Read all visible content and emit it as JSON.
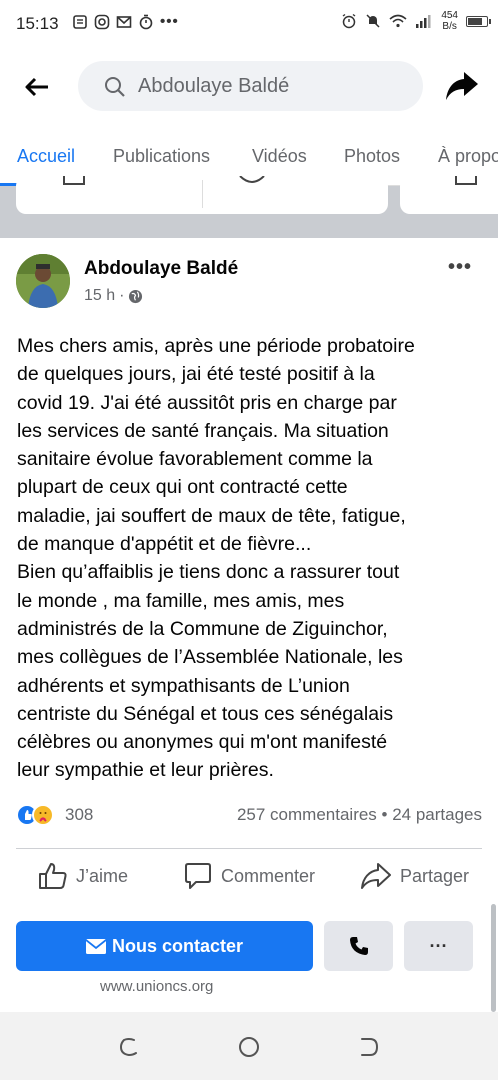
{
  "status_bar": {
    "time": "15:13",
    "left_icons": [
      "message-icon",
      "instagram-icon",
      "gmail-icon",
      "timer-icon",
      "more-dots-icon"
    ],
    "net_speed_value": "454",
    "net_speed_unit": "B/s",
    "right_icons": [
      "alarm-icon",
      "mute-icon",
      "wifi-icon",
      "signal-icon",
      "battery-icon"
    ],
    "battery_level": 0.7
  },
  "search": {
    "query": "Abdoulaye Baldé"
  },
  "tabs": [
    {
      "label": "Accueil",
      "active": true
    },
    {
      "label": "Publications",
      "active": false
    },
    {
      "label": "Vidéos",
      "active": false
    },
    {
      "label": "Photos",
      "active": false
    },
    {
      "label": "À propo",
      "active": false
    }
  ],
  "post": {
    "author": "Abdoulaye Baldé",
    "time": "15 h",
    "audience_icon": "globe-icon",
    "text": "Mes chers amis, après une période probatoire\nde quelques jours, jai été testé positif à la\ncovid 19. J'ai été aussitôt  pris en charge par\nles services  de santé français. Ma situation\nsanitaire évolue favorablement comme la\nplupart de ceux qui ont contracté  cette\nmaladie, jai souffert  de maux de tête, fatigue,\nde manque d'appétit et de fièvre...\nBien qu’affaiblis je tiens donc a rassurer  tout\nle monde , ma famille, mes amis, mes\nadministrés de la Commune de Ziguinchor,\nmes collègues  de l’Assemblée Nationale, les\nadhérents et sympathisants de L’union\ncentriste du Sénégal et tous ces sénégalais\ncélèbres ou anonymes qui m'ont manifesté\nleur sympathie  et leur prières.",
    "reaction_count": "308",
    "stats": "257 commentaires • 24 partages",
    "actions": {
      "like": "J’aime",
      "comment": "Commenter",
      "share": "Partager"
    }
  },
  "cta": {
    "contact_label": "Nous contacter",
    "website": "www.unioncs.org"
  },
  "colors": {
    "accent": "#1877f2",
    "secondary_text": "#65676b",
    "button_gray": "#e4e6eb"
  }
}
